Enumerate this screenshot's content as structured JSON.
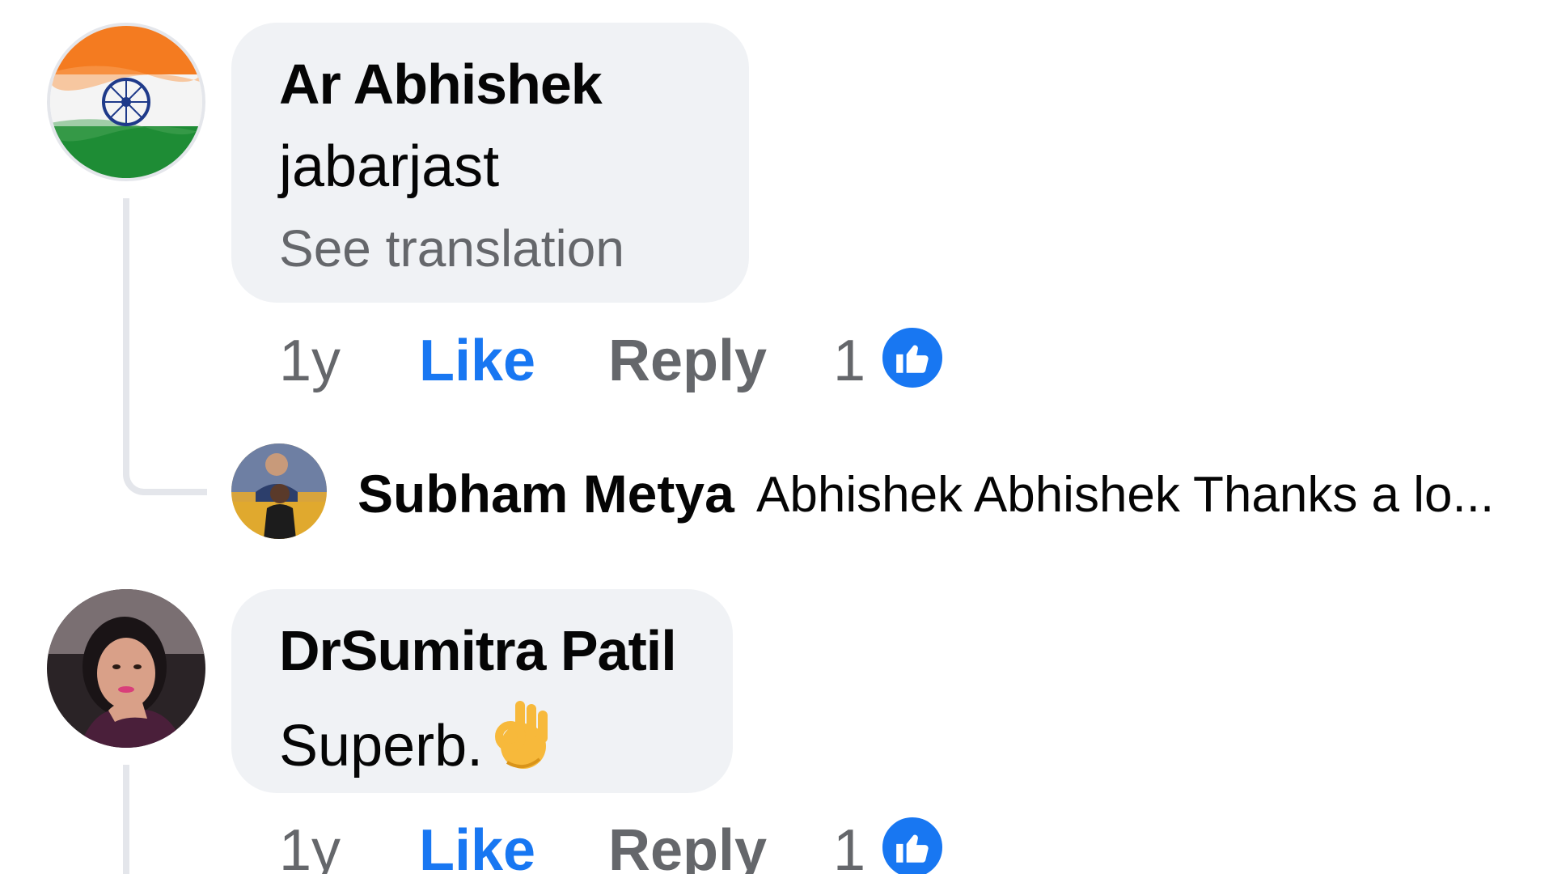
{
  "comments": [
    {
      "author": "Ar Abhishek",
      "text": "jabarjast",
      "see_translation": "See translation",
      "time": "1y",
      "like_label": "Like",
      "reply_label": "Reply",
      "reaction_count": "1",
      "reaction_icon": "thumbs-up-icon",
      "avatar_icon": "india-flag-avatar",
      "reply_preview": {
        "author": "Subham Metya",
        "snippet": "Abhishek Abhishek Thanks a lo..."
      }
    },
    {
      "author": "DrSumitra Patil",
      "text": "Superb.",
      "emoji": "ok-hand-emoji",
      "time": "1y",
      "like_label": "Like",
      "reply_label": "Reply",
      "reaction_count": "1",
      "reaction_icon": "thumbs-up-icon",
      "avatar_icon": "profile-photo-avatar"
    }
  ],
  "colors": {
    "bubble_bg": "#f0f2f5",
    "like_blue": "#1877f2",
    "secondary_text": "#65676b",
    "thread_line": "#e4e6eb"
  }
}
